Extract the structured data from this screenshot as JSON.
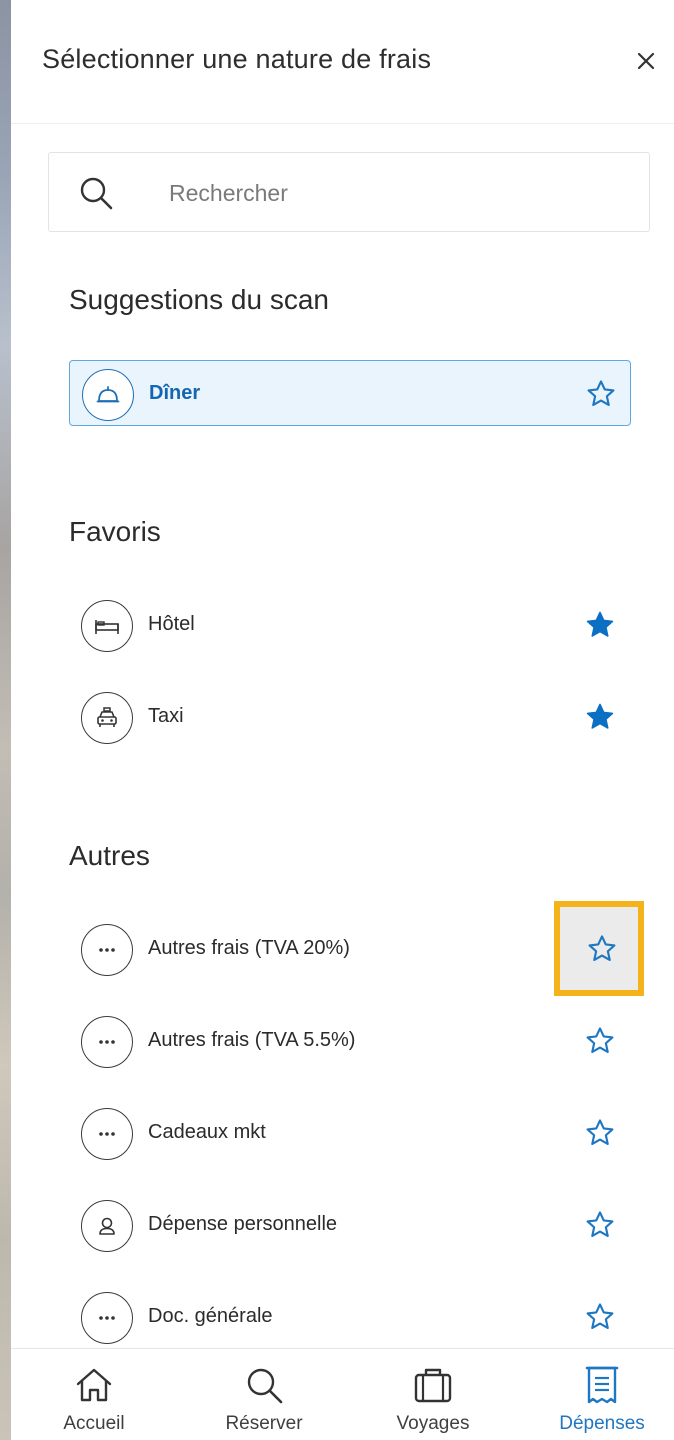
{
  "header": {
    "title": "Sélectionner une nature de frais",
    "close_label": "×"
  },
  "search": {
    "placeholder": "Rechercher",
    "value": ""
  },
  "sections": {
    "suggestions": {
      "title": "Suggestions du scan",
      "items": [
        {
          "label": "Dîner",
          "icon": "cloche-icon",
          "favorite": false
        }
      ]
    },
    "favoris": {
      "title": "Favoris",
      "items": [
        {
          "label": "Hôtel",
          "icon": "bed-icon",
          "favorite": true
        },
        {
          "label": "Taxi",
          "icon": "taxi-icon",
          "favorite": true
        }
      ]
    },
    "autres": {
      "title": "Autres",
      "items": [
        {
          "label": "Autres frais (TVA 20%)",
          "icon": "ellipsis-icon",
          "favorite": false
        },
        {
          "label": "Autres frais (TVA 5.5%)",
          "icon": "ellipsis-icon",
          "favorite": false
        },
        {
          "label": "Cadeaux mkt",
          "icon": "ellipsis-icon",
          "favorite": false
        },
        {
          "label": "Dépense personnelle",
          "icon": "person-icon",
          "favorite": false
        },
        {
          "label": "Doc. générale",
          "icon": "ellipsis-icon",
          "favorite": false
        }
      ]
    }
  },
  "bottom_nav": [
    {
      "label": "Accueil",
      "icon": "home-icon",
      "active": false
    },
    {
      "label": "Réserver",
      "icon": "search-icon",
      "active": false
    },
    {
      "label": "Voyages",
      "icon": "suitcase-icon",
      "active": false
    },
    {
      "label": "Dépenses",
      "icon": "receipt-icon",
      "active": true
    }
  ],
  "colors": {
    "accent": "#1f77c2",
    "star_filled": "#0b6fc4",
    "highlight": "#f4b21b",
    "suggestion_bg": "#e9f4fd"
  }
}
